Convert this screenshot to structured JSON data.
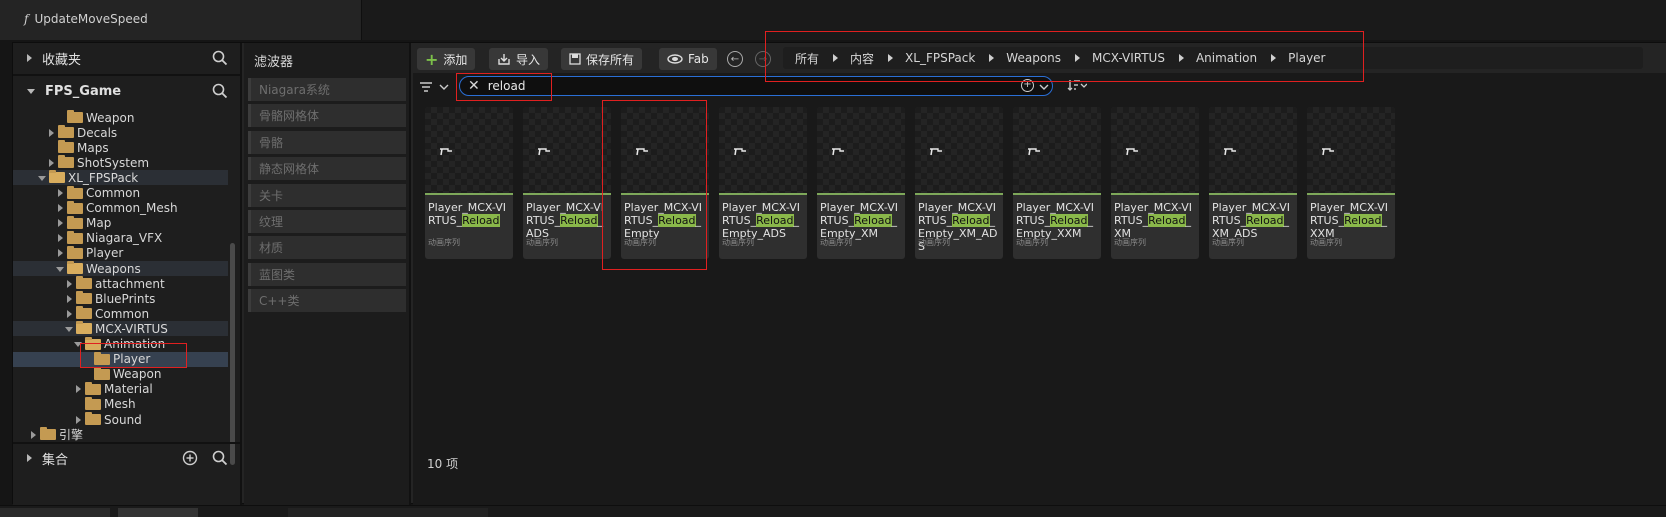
{
  "background": {
    "function_item": "UpdateMoveSpeed",
    "function_prefix": "f"
  },
  "left_panel": {
    "favorites": "收藏夹",
    "project": "FPS_Game",
    "collections": "集合",
    "tree": [
      {
        "label": "Weapon",
        "depth": 4,
        "state": "none"
      },
      {
        "label": "Decals",
        "depth": 3,
        "state": "closed"
      },
      {
        "label": "Maps",
        "depth": 3,
        "state": "none"
      },
      {
        "label": "ShotSystem",
        "depth": 3,
        "state": "closed"
      },
      {
        "label": "XL_FPSPack",
        "depth": 2,
        "state": "open",
        "highlight": true
      },
      {
        "label": "Common",
        "depth": 4,
        "state": "closed"
      },
      {
        "label": "Common_Mesh",
        "depth": 4,
        "state": "closed"
      },
      {
        "label": "Map",
        "depth": 4,
        "state": "closed"
      },
      {
        "label": "Niagara_VFX",
        "depth": 4,
        "state": "closed"
      },
      {
        "label": "Player",
        "depth": 4,
        "state": "closed"
      },
      {
        "label": "Weapons",
        "depth": 4,
        "state": "open",
        "highlight": true
      },
      {
        "label": "attachment",
        "depth": 5,
        "state": "closed"
      },
      {
        "label": "BluePrints",
        "depth": 5,
        "state": "closed"
      },
      {
        "label": "Common",
        "depth": 5,
        "state": "closed"
      },
      {
        "label": "MCX-VIRTUS",
        "depth": 5,
        "state": "open",
        "highlight": true
      },
      {
        "label": "Animation",
        "depth": 6,
        "state": "open"
      },
      {
        "label": "Player",
        "depth": 7,
        "state": "none",
        "selected": true
      },
      {
        "label": "Weapon",
        "depth": 7,
        "state": "none"
      },
      {
        "label": "Material",
        "depth": 6,
        "state": "closed"
      },
      {
        "label": "Mesh",
        "depth": 6,
        "state": "none"
      },
      {
        "label": "Sound",
        "depth": 6,
        "state": "closed"
      },
      {
        "label": "引擎",
        "depth": 1,
        "state": "closed"
      }
    ]
  },
  "filters": {
    "title": "滤波器",
    "items": [
      "Niagara系统",
      "骨骼网格体",
      "骨骼",
      "静态网格体",
      "关卡",
      "纹理",
      "材质",
      "蓝图类",
      "C++类"
    ]
  },
  "toolbar": {
    "add": "添加",
    "import": "导入",
    "save_all": "保存所有",
    "fab": "Fab"
  },
  "breadcrumb": [
    "所有",
    "内容",
    "XL_FPSPack",
    "Weapons",
    "MCX-VIRTUS",
    "Animation",
    "Player"
  ],
  "search": {
    "value": "reload"
  },
  "assets": [
    {
      "pre": "Player_MCX-VIRTUS_",
      "match": "Reload",
      "post": "",
      "type": "动画序列"
    },
    {
      "pre": "Player_MCX-VIRTUS_",
      "match": "Reload",
      "post": "_ADS",
      "type": "动画序列"
    },
    {
      "pre": "Player_MCX-VIRTUS_",
      "match": "Reload",
      "post": "_Empty",
      "type": "动画序列"
    },
    {
      "pre": "Player_MCX-VIRTUS_",
      "match": "Reload",
      "post": "_Empty_ADS",
      "type": "动画序列"
    },
    {
      "pre": "Player_MCX-VIRTUS_",
      "match": "Reload",
      "post": "_Empty_XM",
      "type": "动画序列"
    },
    {
      "pre": "Player_MCX-VIRTUS_",
      "match": "Reload",
      "post": "_Empty_XM_ADS",
      "type": "动画序列"
    },
    {
      "pre": "Player_MCX-VIRTUS_",
      "match": "Reload",
      "post": "_Empty_XXM",
      "type": "动画序列"
    },
    {
      "pre": "Player_MCX-VIRTUS_",
      "match": "Reload",
      "post": "_XM",
      "type": "动画序列"
    },
    {
      "pre": "Player_MCX-VIRTUS_",
      "match": "Reload",
      "post": "_XM_ADS",
      "type": "动画序列"
    },
    {
      "pre": "Player_MCX-VIRTUS_",
      "match": "Reload",
      "post": "_XXM",
      "type": "动画序列"
    }
  ],
  "item_count": "10 项",
  "colors": {
    "accent_blue": "#2a6fd6",
    "highlight_green": "#8ab84a",
    "annotation_red": "#e02020",
    "folder": "#c49a52"
  }
}
